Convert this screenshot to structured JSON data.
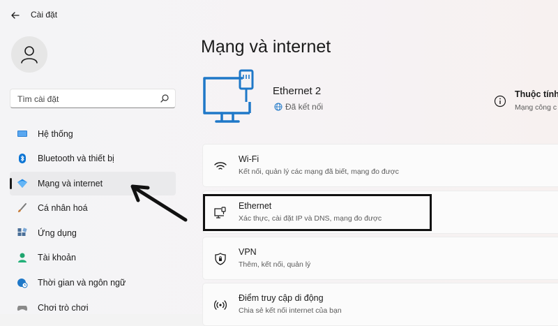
{
  "titlebar": {
    "title": "Cài đặt",
    "back_icon": "arrow-left-icon"
  },
  "sidebar": {
    "search_placeholder": "Tìm cài đặt",
    "items": [
      {
        "label": "Hệ thống",
        "icon": "monitor-icon",
        "color": "#0067c0"
      },
      {
        "label": "Bluetooth và thiết bị",
        "icon": "bluetooth-icon",
        "color": "#0067c0"
      },
      {
        "label": "Mạng và internet",
        "icon": "wifi-diamond-icon",
        "color": "#0078d4",
        "selected": true
      },
      {
        "label": "Cá nhân hoá",
        "icon": "brush-icon",
        "color": "#6b6b6b"
      },
      {
        "label": "Ứng dụng",
        "icon": "apps-icon",
        "color": "#3a6ea5"
      },
      {
        "label": "Tài khoản",
        "icon": "person-icon",
        "color": "#1e9e6a"
      },
      {
        "label": "Thời gian và ngôn ngữ",
        "icon": "globe-clock-icon",
        "color": "#0067c0"
      },
      {
        "label": "Chơi trò chơi",
        "icon": "gamepad-icon",
        "color": "#6b6b6b"
      }
    ]
  },
  "main": {
    "title": "Mạng và internet",
    "connection": {
      "name": "Ethernet 2",
      "status": "Đã kết nối"
    },
    "properties": {
      "title": "Thuộc tính",
      "subtitle": "Mạng công c"
    },
    "cards": [
      {
        "title": "Wi-Fi",
        "subtitle": "Kết nối, quản lý các mạng đã biết, mạng đo được",
        "icon": "wifi-icon"
      },
      {
        "title": "Ethernet",
        "subtitle": "Xác thực, cài đặt IP và DNS, mạng đo được",
        "icon": "ethernet-icon"
      },
      {
        "title": "VPN",
        "subtitle": "Thêm, kết nối, quản lý",
        "icon": "shield-icon"
      },
      {
        "title": "Điểm truy cập di động",
        "subtitle": "Chia sẻ kết nối internet của bạn",
        "icon": "hotspot-icon"
      }
    ]
  },
  "colors": {
    "accent": "#0067c0",
    "hero_icon": "#1f78c8",
    "highlight": "#111111"
  }
}
